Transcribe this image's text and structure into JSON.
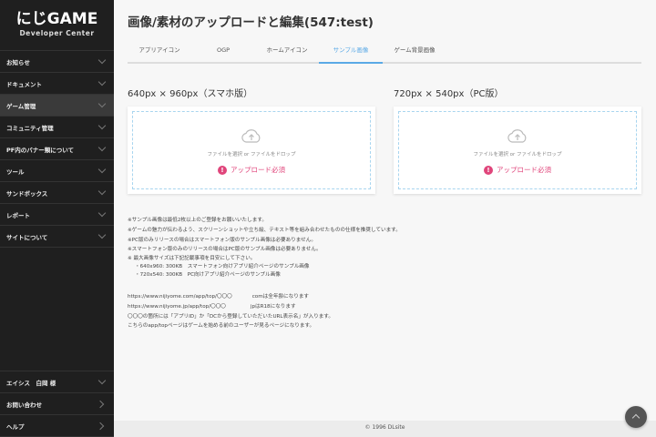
{
  "sidebar": {
    "logo_main": "にじGAME",
    "logo_sub": "Developer Center",
    "items": [
      {
        "label": "お知らせ"
      },
      {
        "label": "ドキュメント"
      },
      {
        "label": "ゲーム管理",
        "active": true
      },
      {
        "label": "コミュニティ管理"
      },
      {
        "label": "PF内のバナー類について"
      },
      {
        "label": "ツール"
      },
      {
        "label": "サンドボックス"
      },
      {
        "label": "レポート"
      },
      {
        "label": "サイトについて"
      }
    ],
    "bottom": [
      {
        "label": "エイシス　白岡 様"
      },
      {
        "label": "お問い合わせ"
      },
      {
        "label": "ヘルプ"
      }
    ]
  },
  "main": {
    "title": "画像/素材のアップロードと編集(547:test)",
    "tabs": [
      {
        "label": "アプリアイコン"
      },
      {
        "label": "OGP"
      },
      {
        "label": "ホームアイコン"
      },
      {
        "label": "サンプル画像",
        "active": true
      },
      {
        "label": "ゲーム背景画像"
      }
    ],
    "uploads": [
      {
        "heading": "640px × 960px（スマホ版）",
        "hint": "ファイルを選択 or ファイルをドロップ",
        "required": "アップロード必須"
      },
      {
        "heading": "720px × 540px（PC版）",
        "hint": "ファイルを選択 or ファイルをドロップ",
        "required": "アップロード必須"
      }
    ],
    "notes": [
      "※サンプル画像は最低2枚以上のご登録をお願いいたします。",
      "※ゲームの魅力が伝わるよう、スクリーンショットや立ち絵、テキスト等を組み合わせたものの仕様を推奨しています。",
      "※PC版のみリリースの場合はスマートフォン版のサンプル画像は必要ありません。",
      "※スマートフォン版のみのリリースの場合はPC版のサンプル画像は必要ありません。",
      "※ 最大画像サイズは下記記載事項を目安にして下さい。",
      "・640x960: 300KB　スマートフォン向けアプリ紹介ページのサンプル画像",
      "・720x540: 300KB　PC向けアプリ紹介ページのサンプル画像"
    ],
    "urls": [
      {
        "url": "https://www.nijiyome.com/app/top/〇〇〇",
        "desc": "comは全年齢になります"
      },
      {
        "url": "https://www.nijiyome.jp/app/top/〇〇〇",
        "desc": "jpはR18になります"
      }
    ],
    "url_notes": [
      "〇〇〇の箇所には「アプリID」か「DCから登録していただいたURL表示名」が入ります。",
      "こちらのapp/topページはゲームを始める前のユーザーが見るページになります。"
    ]
  },
  "footer": {
    "copyright": "© 1996 DLsite"
  },
  "colors": {
    "accent": "#5aa9e6",
    "required": "#e0457b",
    "sidebar": "#1f1f1f"
  }
}
